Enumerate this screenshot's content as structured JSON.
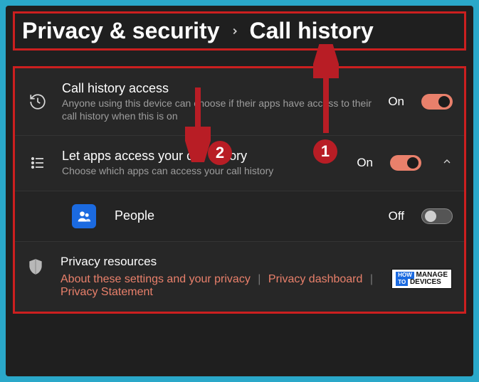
{
  "breadcrumb": {
    "parent": "Privacy & security",
    "current": "Call history"
  },
  "rows": {
    "access": {
      "title": "Call history access",
      "desc": "Anyone using this device can choose if their apps have access to their call history when this is on",
      "state": "On"
    },
    "apps": {
      "title": "Let apps access your call history",
      "desc": "Choose which apps can access your call history",
      "state": "On"
    },
    "people": {
      "title": "People",
      "state": "Off"
    }
  },
  "resources": {
    "title": "Privacy resources",
    "links": {
      "about": "About these settings and your privacy",
      "dashboard": "Privacy dashboard",
      "statement": "Privacy Statement"
    }
  },
  "annotations": {
    "badge1": "1",
    "badge2": "2"
  },
  "watermark": {
    "how": "HOW",
    "to": "TO",
    "manage": "MANAGE",
    "devices": "DEVICES"
  }
}
